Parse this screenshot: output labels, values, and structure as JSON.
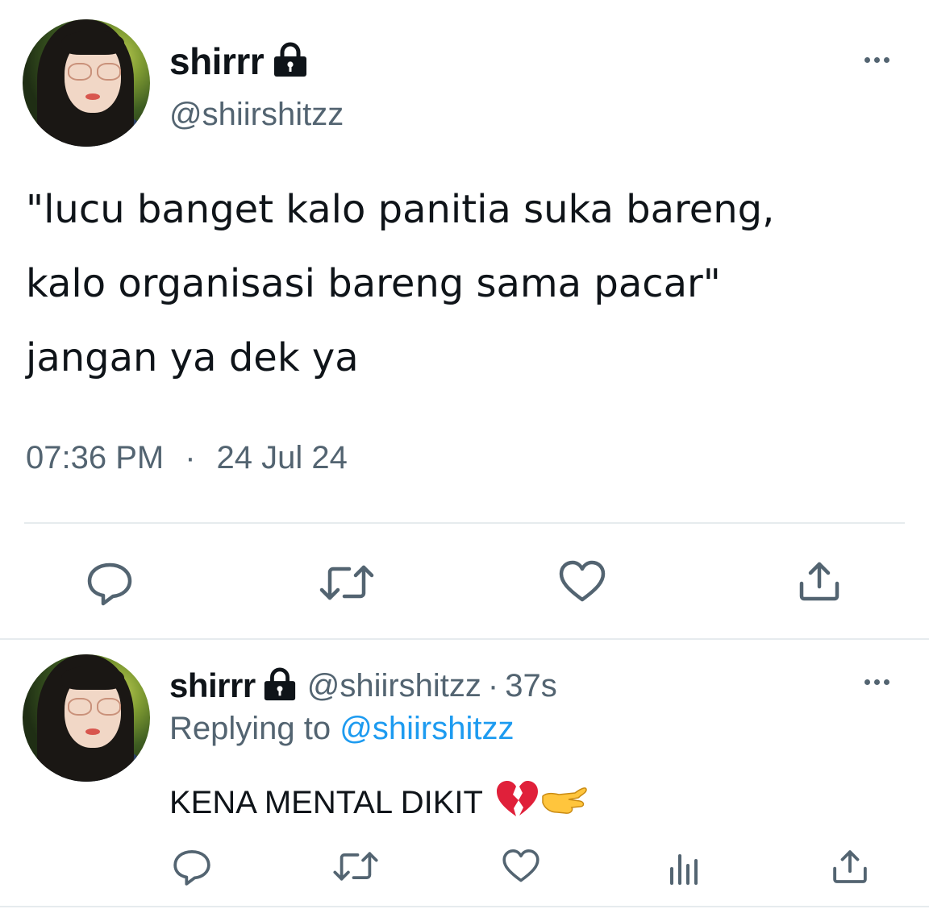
{
  "main_tweet": {
    "display_name": "shirrr",
    "handle": "@shiirshitzz",
    "text_lines": [
      "\"lucu banget kalo panitia suka bareng,",
      "kalo organisasi bareng sama pacar\"",
      "jangan ya dek ya"
    ],
    "time": "07:36 PM",
    "separator": "·",
    "date": "24 Jul 24",
    "icons": {
      "locked": "lock-icon",
      "more": "more-icon",
      "reply": "reply-icon",
      "retweet": "retweet-icon",
      "like": "like-icon",
      "share": "share-icon"
    }
  },
  "reply_tweet": {
    "display_name": "shirrr",
    "handle": "@shiirshitzz",
    "separator": "·",
    "age": "37s",
    "replying_prefix": "Replying to",
    "replying_to": "@shiirshitzz",
    "text": "KENA MENTAL DIKIT",
    "emoji": "💔🫰",
    "icons": {
      "reply": "reply-icon",
      "retweet": "retweet-icon",
      "like": "like-icon",
      "views": "views-icon",
      "share": "share-icon"
    }
  },
  "colors": {
    "text": "#0f1419",
    "secondary": "#536471",
    "link": "#1d9bf0",
    "divider": "#e6ebee"
  }
}
